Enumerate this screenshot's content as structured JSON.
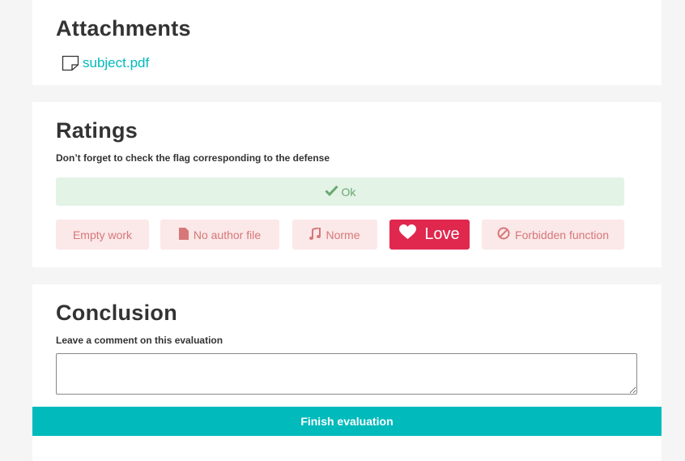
{
  "attachments": {
    "title": "Attachments",
    "file": {
      "icon": "file-icon",
      "name": "subject.pdf"
    }
  },
  "ratings": {
    "title": "Ratings",
    "subtitle": "Don’t forget to check the flag corresponding to the defense",
    "ok": {
      "icon": "check-icon",
      "label": "Ok"
    },
    "flags": {
      "empty_work": "Empty work",
      "no_author_file": {
        "icon": "file-icon",
        "label": "No author file"
      },
      "norme": {
        "icon": "music-note-icon",
        "label": "Norme"
      },
      "love": {
        "icon": "heart-icon",
        "label": "Love"
      },
      "forbidden_function": {
        "icon": "ban-icon",
        "label": "Forbidden function"
      }
    }
  },
  "conclusion": {
    "title": "Conclusion",
    "comment_label": "Leave a comment on this evaluation",
    "comment_value": "",
    "finish_label": "Finish evaluation"
  },
  "colors": {
    "accent": "#00babc",
    "ok_bg": "#e3f3e6",
    "ok_text": "#6aa86f",
    "flag_bg": "#fbe8e8",
    "flag_text": "#d77779",
    "love_bg": "#e0284f"
  }
}
